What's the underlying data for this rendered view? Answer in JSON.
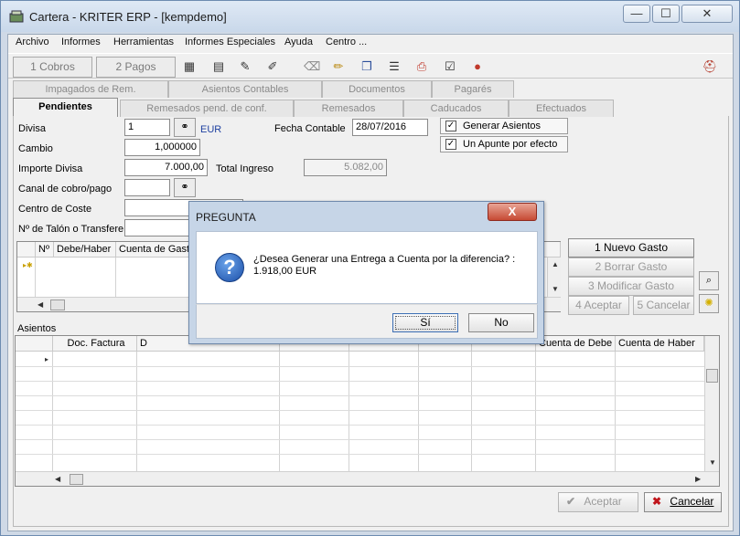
{
  "window": {
    "title": "Cartera - KRITER ERP - [kempdemo]",
    "min_glyph": "—",
    "max_glyph": "☐",
    "close_glyph": "✕"
  },
  "menu": [
    "Archivo",
    "Informes",
    "Herramientas",
    "Informes Especiales",
    "Ayuda",
    "Centro ..."
  ],
  "toolbar": {
    "cobros": "1 Cobros",
    "pagos": "2 Pagos"
  },
  "tabs_row1": [
    "Impagados de Rem.",
    "Asientos Contables",
    "Documentos",
    "Pagarés"
  ],
  "tabs_row2": [
    "Pendientes",
    "Remesados pend. de conf.",
    "Remesados",
    "Caducados",
    "Efectuados"
  ],
  "form": {
    "divisa_label": "Divisa",
    "divisa_value": "1",
    "divisa_code": "EUR",
    "cambio_label": "Cambio",
    "cambio_value": "1,000000",
    "importe_label": "Importe Divisa",
    "importe_value": "7.000,00",
    "total_ingreso_label": "Total Ingreso",
    "total_ingreso_value": "5.082,00",
    "canal_label": "Canal de cobro/pago",
    "centro_label": "Centro de Coste",
    "talon_label": "Nº de Talón o Transfere",
    "fecha_label": "Fecha Contable",
    "fecha_value": "28/07/2016",
    "generar_label": "Generar Asientos",
    "generar_checked": true,
    "apunte_label": "Un Apunte por efecto",
    "apunte_checked": true
  },
  "gastos_grid": {
    "headers": [
      "Nº",
      "Debe/Haber",
      "Cuenta de Gasto"
    ]
  },
  "gastos_buttons": {
    "nuevo": "1 Nuevo Gasto",
    "borrar": "2 Borrar Gasto",
    "modificar": "3 Modificar Gasto",
    "aceptar": "4 Aceptar",
    "cancelar": "5 Cancelar"
  },
  "asientos": {
    "label": "Asientos",
    "headers": [
      "Doc. Factura",
      "D",
      "",
      "",
      "",
      "",
      "Cuenta de Debe",
      "Cuenta de Haber"
    ]
  },
  "footer": {
    "aceptar": "Aceptar",
    "cancelar": "Cancelar"
  },
  "dialog": {
    "title": "PREGUNTA",
    "close_glyph": "X",
    "icon_glyph": "?",
    "message_line1": "¿Desea Generar una Entrega a Cuenta por la diferencia? :",
    "message_line2": "1.918,00 EUR",
    "yes": "Sí",
    "no": "No"
  }
}
